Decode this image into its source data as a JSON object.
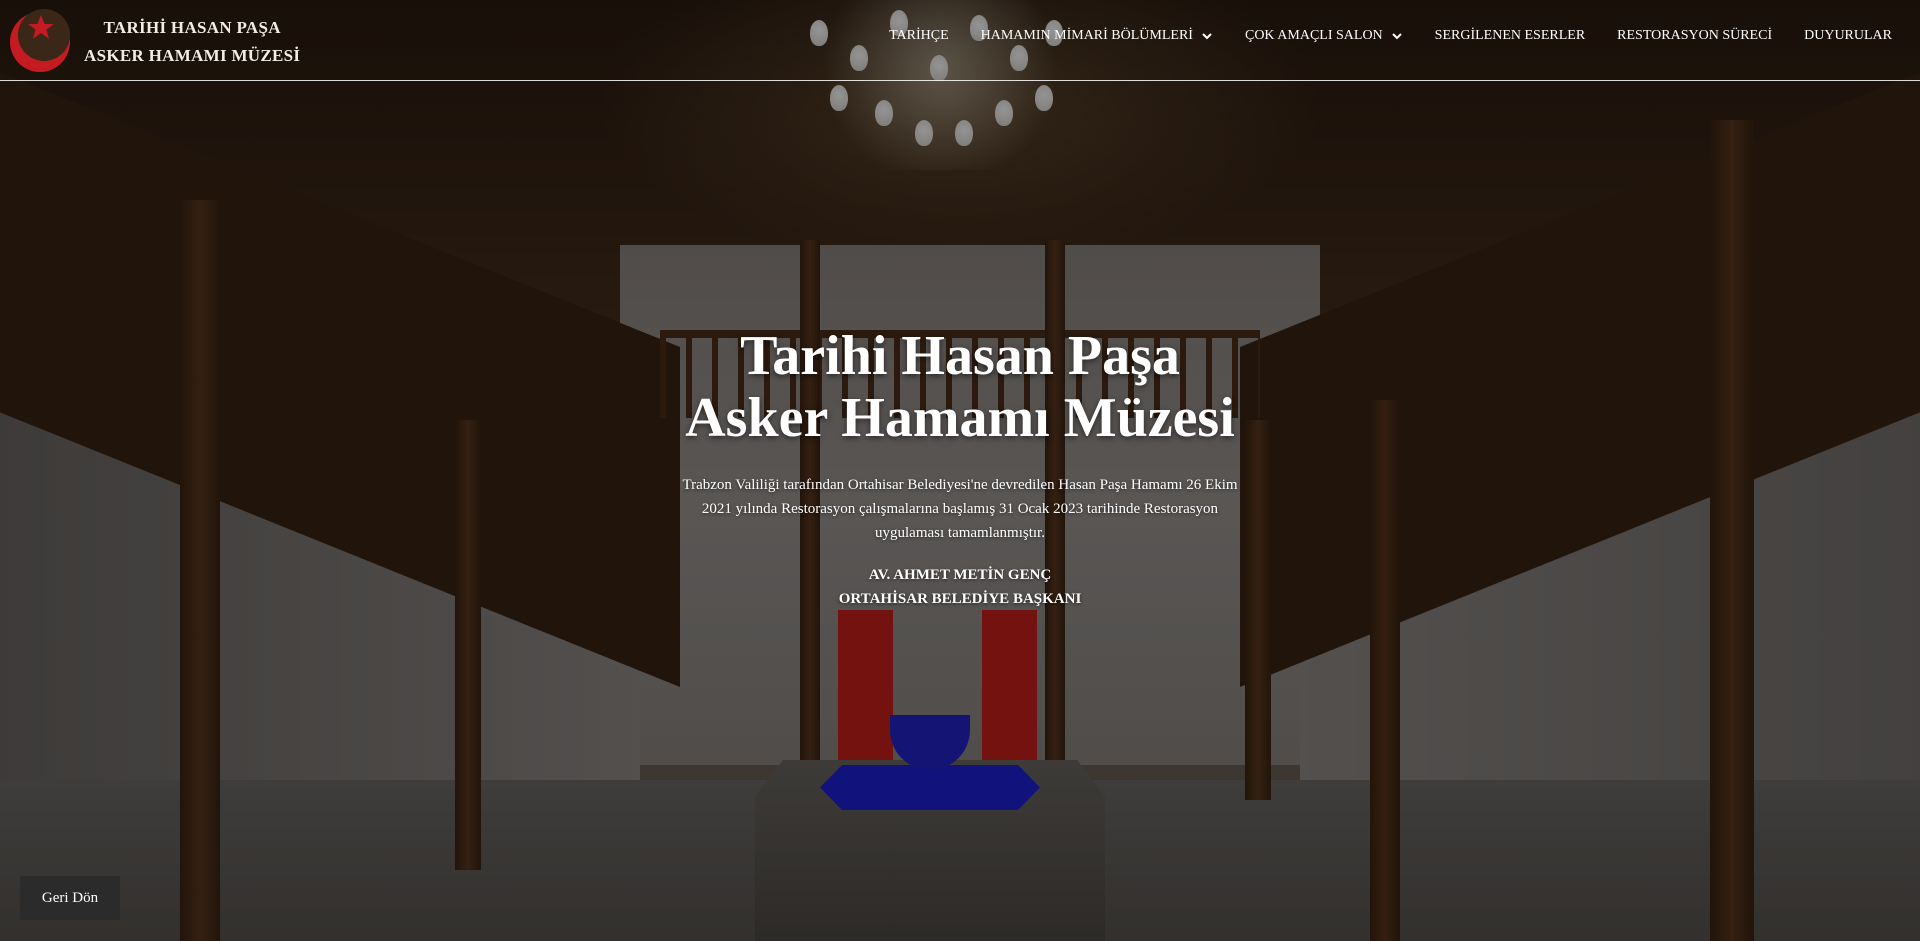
{
  "brand": {
    "line1": "TARİHİ HASAN PAŞA",
    "line2": "ASKER HAMAMI MÜZESİ",
    "logo_icon": "crescent-star-icon",
    "logo_color": "#c41a22"
  },
  "nav": {
    "items": [
      {
        "label": "TARİHÇE",
        "has_dropdown": false
      },
      {
        "label": "HAMAMIN MİMARİ BÖLÜMLERİ",
        "has_dropdown": true
      },
      {
        "label": "ÇOK AMAÇLI SALON",
        "has_dropdown": true
      },
      {
        "label": "SERGİLENEN ESERLER",
        "has_dropdown": false
      },
      {
        "label": "RESTORASYON SÜRECİ",
        "has_dropdown": false
      },
      {
        "label": "DUYURULAR",
        "has_dropdown": false
      }
    ]
  },
  "hero": {
    "title_line1": "Tarihi Hasan Paşa",
    "title_line2": "Asker Hamamı Müzesi",
    "description": "Trabzon Valiliği tarafından Ortahisar Belediyesi'ne devredilen Hasan Paşa Hamamı 26 Ekim 2021 yılında Restorasyon çalışmalarına başlamış 31 Ocak 2023 tarihinde Restorasyon uygulaması tamamlanmıştır.",
    "signature_name": "AV. AHMET METİN GENÇ",
    "signature_title": "ORTAHİSAR BELEDİYE BAŞKANI"
  },
  "back_button": {
    "label": "Geri Dön"
  }
}
